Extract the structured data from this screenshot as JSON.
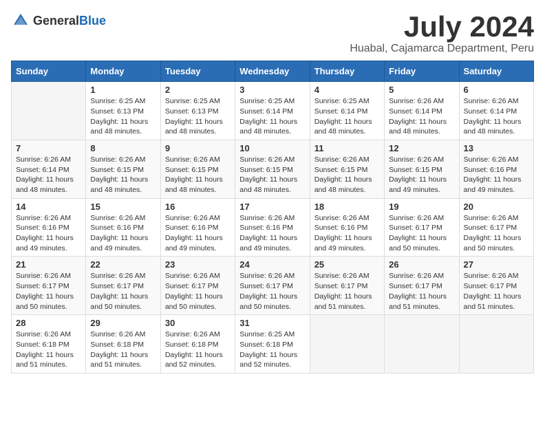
{
  "logo": {
    "general": "General",
    "blue": "Blue"
  },
  "title": {
    "month": "July 2024",
    "location": "Huabal, Cajamarca Department, Peru"
  },
  "headers": [
    "Sunday",
    "Monday",
    "Tuesday",
    "Wednesday",
    "Thursday",
    "Friday",
    "Saturday"
  ],
  "weeks": [
    [
      {
        "day": "",
        "sunrise": "",
        "sunset": "",
        "daylight": ""
      },
      {
        "day": "1",
        "sunrise": "Sunrise: 6:25 AM",
        "sunset": "Sunset: 6:13 PM",
        "daylight": "Daylight: 11 hours and 48 minutes."
      },
      {
        "day": "2",
        "sunrise": "Sunrise: 6:25 AM",
        "sunset": "Sunset: 6:13 PM",
        "daylight": "Daylight: 11 hours and 48 minutes."
      },
      {
        "day": "3",
        "sunrise": "Sunrise: 6:25 AM",
        "sunset": "Sunset: 6:14 PM",
        "daylight": "Daylight: 11 hours and 48 minutes."
      },
      {
        "day": "4",
        "sunrise": "Sunrise: 6:25 AM",
        "sunset": "Sunset: 6:14 PM",
        "daylight": "Daylight: 11 hours and 48 minutes."
      },
      {
        "day": "5",
        "sunrise": "Sunrise: 6:26 AM",
        "sunset": "Sunset: 6:14 PM",
        "daylight": "Daylight: 11 hours and 48 minutes."
      },
      {
        "day": "6",
        "sunrise": "Sunrise: 6:26 AM",
        "sunset": "Sunset: 6:14 PM",
        "daylight": "Daylight: 11 hours and 48 minutes."
      }
    ],
    [
      {
        "day": "7",
        "sunrise": "Sunrise: 6:26 AM",
        "sunset": "Sunset: 6:14 PM",
        "daylight": "Daylight: 11 hours and 48 minutes."
      },
      {
        "day": "8",
        "sunrise": "Sunrise: 6:26 AM",
        "sunset": "Sunset: 6:15 PM",
        "daylight": "Daylight: 11 hours and 48 minutes."
      },
      {
        "day": "9",
        "sunrise": "Sunrise: 6:26 AM",
        "sunset": "Sunset: 6:15 PM",
        "daylight": "Daylight: 11 hours and 48 minutes."
      },
      {
        "day": "10",
        "sunrise": "Sunrise: 6:26 AM",
        "sunset": "Sunset: 6:15 PM",
        "daylight": "Daylight: 11 hours and 48 minutes."
      },
      {
        "day": "11",
        "sunrise": "Sunrise: 6:26 AM",
        "sunset": "Sunset: 6:15 PM",
        "daylight": "Daylight: 11 hours and 48 minutes."
      },
      {
        "day": "12",
        "sunrise": "Sunrise: 6:26 AM",
        "sunset": "Sunset: 6:15 PM",
        "daylight": "Daylight: 11 hours and 49 minutes."
      },
      {
        "day": "13",
        "sunrise": "Sunrise: 6:26 AM",
        "sunset": "Sunset: 6:16 PM",
        "daylight": "Daylight: 11 hours and 49 minutes."
      }
    ],
    [
      {
        "day": "14",
        "sunrise": "Sunrise: 6:26 AM",
        "sunset": "Sunset: 6:16 PM",
        "daylight": "Daylight: 11 hours and 49 minutes."
      },
      {
        "day": "15",
        "sunrise": "Sunrise: 6:26 AM",
        "sunset": "Sunset: 6:16 PM",
        "daylight": "Daylight: 11 hours and 49 minutes."
      },
      {
        "day": "16",
        "sunrise": "Sunrise: 6:26 AM",
        "sunset": "Sunset: 6:16 PM",
        "daylight": "Daylight: 11 hours and 49 minutes."
      },
      {
        "day": "17",
        "sunrise": "Sunrise: 6:26 AM",
        "sunset": "Sunset: 6:16 PM",
        "daylight": "Daylight: 11 hours and 49 minutes."
      },
      {
        "day": "18",
        "sunrise": "Sunrise: 6:26 AM",
        "sunset": "Sunset: 6:16 PM",
        "daylight": "Daylight: 11 hours and 49 minutes."
      },
      {
        "day": "19",
        "sunrise": "Sunrise: 6:26 AM",
        "sunset": "Sunset: 6:17 PM",
        "daylight": "Daylight: 11 hours and 50 minutes."
      },
      {
        "day": "20",
        "sunrise": "Sunrise: 6:26 AM",
        "sunset": "Sunset: 6:17 PM",
        "daylight": "Daylight: 11 hours and 50 minutes."
      }
    ],
    [
      {
        "day": "21",
        "sunrise": "Sunrise: 6:26 AM",
        "sunset": "Sunset: 6:17 PM",
        "daylight": "Daylight: 11 hours and 50 minutes."
      },
      {
        "day": "22",
        "sunrise": "Sunrise: 6:26 AM",
        "sunset": "Sunset: 6:17 PM",
        "daylight": "Daylight: 11 hours and 50 minutes."
      },
      {
        "day": "23",
        "sunrise": "Sunrise: 6:26 AM",
        "sunset": "Sunset: 6:17 PM",
        "daylight": "Daylight: 11 hours and 50 minutes."
      },
      {
        "day": "24",
        "sunrise": "Sunrise: 6:26 AM",
        "sunset": "Sunset: 6:17 PM",
        "daylight": "Daylight: 11 hours and 50 minutes."
      },
      {
        "day": "25",
        "sunrise": "Sunrise: 6:26 AM",
        "sunset": "Sunset: 6:17 PM",
        "daylight": "Daylight: 11 hours and 51 minutes."
      },
      {
        "day": "26",
        "sunrise": "Sunrise: 6:26 AM",
        "sunset": "Sunset: 6:17 PM",
        "daylight": "Daylight: 11 hours and 51 minutes."
      },
      {
        "day": "27",
        "sunrise": "Sunrise: 6:26 AM",
        "sunset": "Sunset: 6:17 PM",
        "daylight": "Daylight: 11 hours and 51 minutes."
      }
    ],
    [
      {
        "day": "28",
        "sunrise": "Sunrise: 6:26 AM",
        "sunset": "Sunset: 6:18 PM",
        "daylight": "Daylight: 11 hours and 51 minutes."
      },
      {
        "day": "29",
        "sunrise": "Sunrise: 6:26 AM",
        "sunset": "Sunset: 6:18 PM",
        "daylight": "Daylight: 11 hours and 51 minutes."
      },
      {
        "day": "30",
        "sunrise": "Sunrise: 6:26 AM",
        "sunset": "Sunset: 6:18 PM",
        "daylight": "Daylight: 11 hours and 52 minutes."
      },
      {
        "day": "31",
        "sunrise": "Sunrise: 6:25 AM",
        "sunset": "Sunset: 6:18 PM",
        "daylight": "Daylight: 11 hours and 52 minutes."
      },
      {
        "day": "",
        "sunrise": "",
        "sunset": "",
        "daylight": ""
      },
      {
        "day": "",
        "sunrise": "",
        "sunset": "",
        "daylight": ""
      },
      {
        "day": "",
        "sunrise": "",
        "sunset": "",
        "daylight": ""
      }
    ]
  ]
}
